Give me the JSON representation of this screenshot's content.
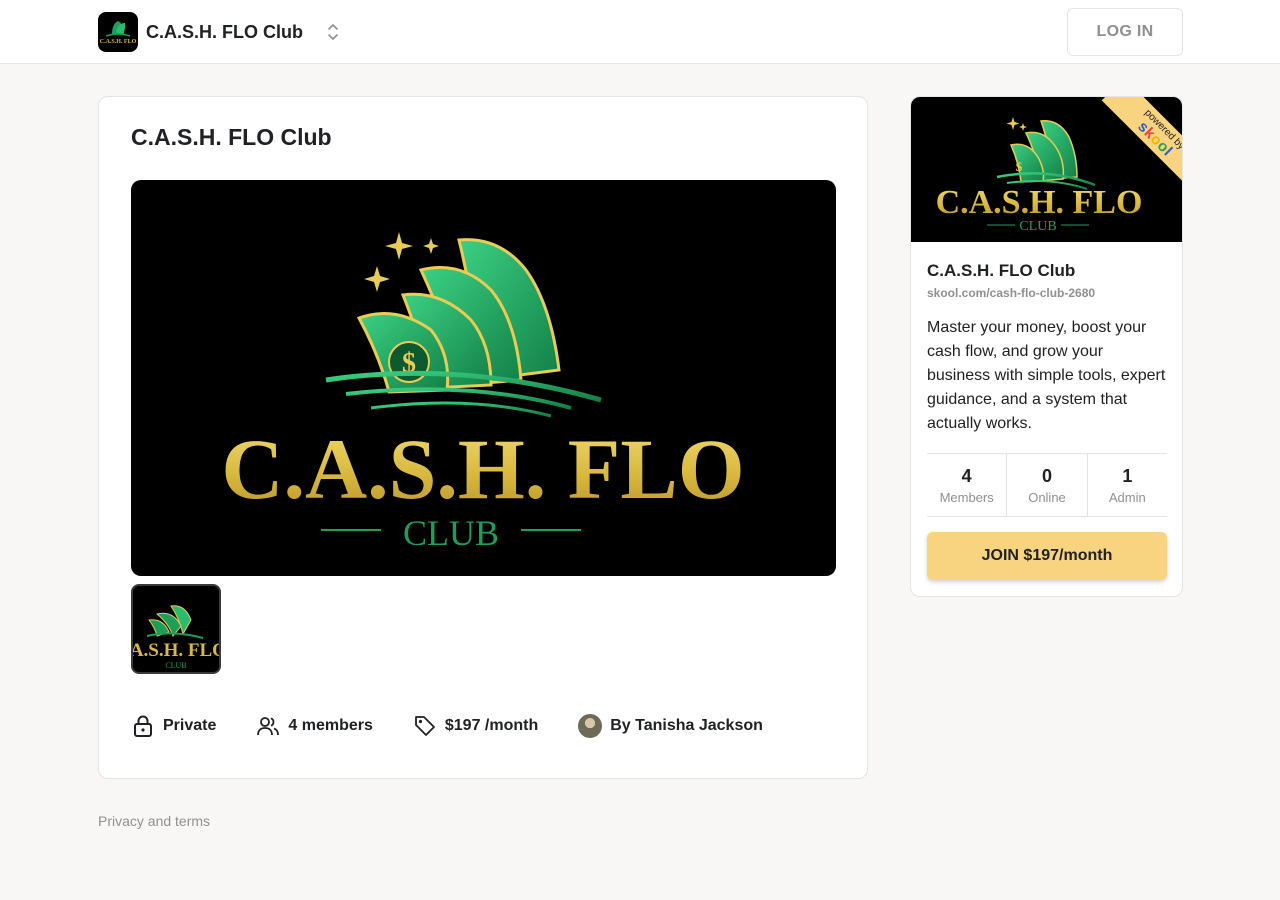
{
  "header": {
    "group_name": "C.A.S.H. FLO Club",
    "login_label": "LOG IN"
  },
  "logo": {
    "title": "C.A.S.H. FLO",
    "subtitle": "CLUB",
    "thumb_title": ".A.S.H. FLO"
  },
  "main": {
    "title": "C.A.S.H. FLO Club",
    "meta": {
      "privacy": "Private",
      "members": "4 members",
      "price": "$197 /month",
      "owner": "By Tanisha Jackson"
    }
  },
  "sidebar": {
    "ribbon_line1": "powered by",
    "ribbon_brand": "skool",
    "title": "C.A.S.H. FLO Club",
    "url": "skool.com/cash-flo-club-2680",
    "description": "Master your money, boost your cash flow, and grow your business with simple tools, expert guidance, and a system that actually works.",
    "stats": [
      {
        "value": "4",
        "label": "Members"
      },
      {
        "value": "0",
        "label": "Online"
      },
      {
        "value": "1",
        "label": "Admin"
      }
    ],
    "join_label": "JOIN $197/month"
  },
  "footer": {
    "privacy_link": "Privacy and terms"
  },
  "colors": {
    "accent": "#f8d481",
    "logo_gold": "#d9b93f",
    "logo_green": "#1f9e5a",
    "muted_text": "#909090"
  },
  "icons": [
    "chevron-up-down-icon",
    "lock-icon",
    "members-icon",
    "price-tag-icon"
  ]
}
